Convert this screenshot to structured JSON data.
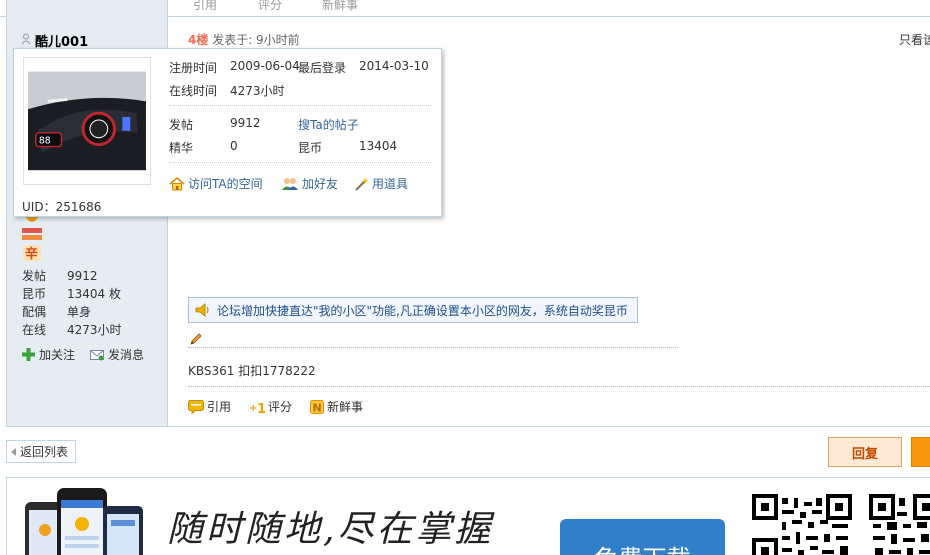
{
  "top_actions": {
    "quote": "引用",
    "rate": "评分",
    "fresh": "新鲜事"
  },
  "author": {
    "name": "酷儿001"
  },
  "post": {
    "floor": "4楼",
    "time_prefix": "发表于: ",
    "time": "9小时前",
    "only_view": "只看该作者"
  },
  "popup": {
    "reg_label": "注册时间",
    "reg_value": "2009-06-04",
    "last_label": "最后登录",
    "last_value": "2014-03-10",
    "online_label": "在线时间",
    "online_value": "4273小时",
    "posts_label": "发帖",
    "posts_value": "9912",
    "search_link": "搜Ta的帖子",
    "digest_label": "精华",
    "digest_value": "0",
    "coins_label": "昆币",
    "coins_value": "13404",
    "visit_space": "访问TA的空间",
    "add_friend": "加好友",
    "use_tool": "用道具",
    "uid": "UID：251686"
  },
  "stats": [
    {
      "label": "发帖",
      "value": "9912"
    },
    {
      "label": "昆币",
      "value": "13404 枚"
    },
    {
      "label": "配偶",
      "value": "单身"
    },
    {
      "label": "在线",
      "value": "4273小时"
    }
  ],
  "author_actions": {
    "follow": "加关注",
    "message": "发消息"
  },
  "notice": "论坛增加快捷直达\"我的小区\"功能,凡正确设置本小区的网友，系统自动奖昆币",
  "signature": "KBS361 扣扣1778222",
  "post_actions": {
    "quote": "引用",
    "rate": "评分",
    "fresh": "新鲜事"
  },
  "nav": {
    "back": "返回列表",
    "reply": "回复"
  },
  "banner": {
    "slogan": "随时随地,尽在掌握",
    "download": "免费下载"
  },
  "colors": {
    "accent": "#336699",
    "floor": "#f26c4f",
    "reply_bg": "#fde9d4",
    "download_bg": "#2f7fc9"
  }
}
